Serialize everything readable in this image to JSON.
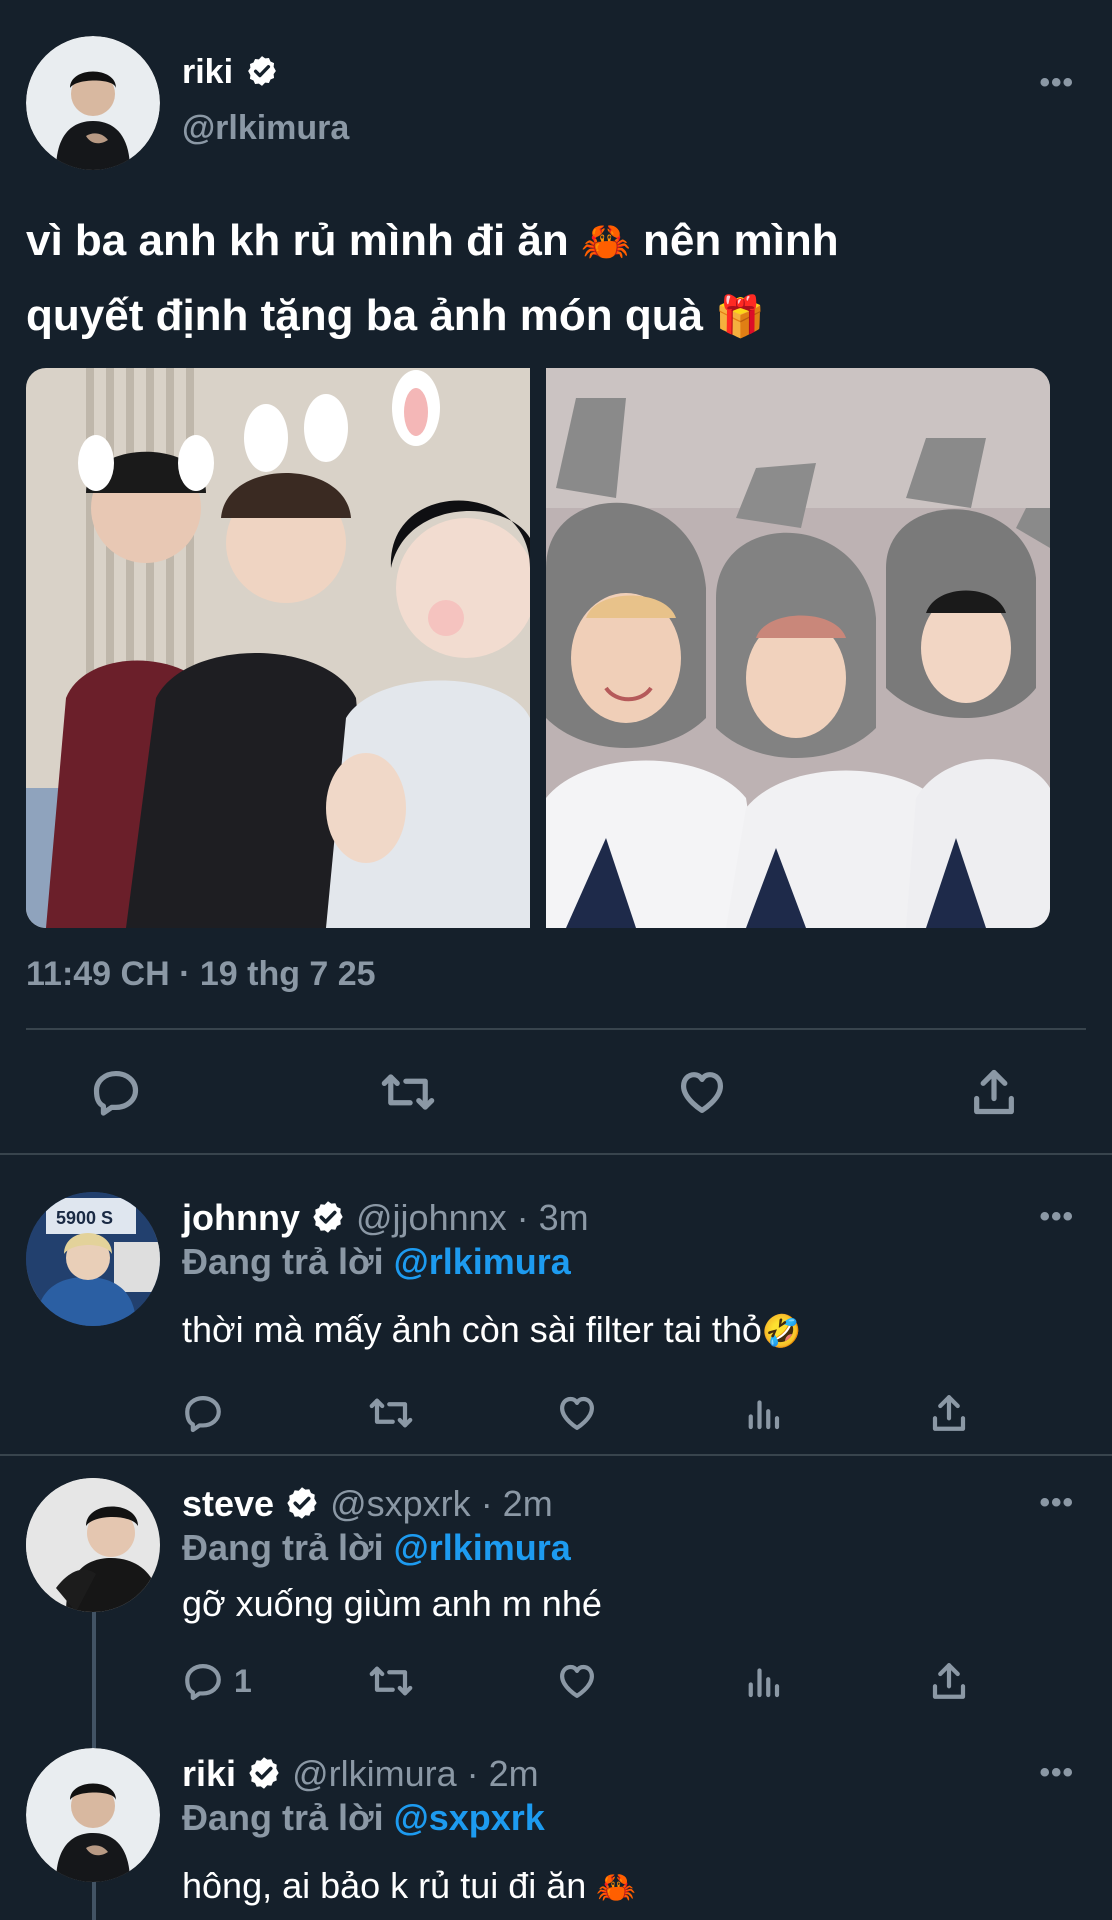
{
  "main_tweet": {
    "display_name": "riki",
    "handle": "@rlkimura",
    "text_line1": "vì ba anh kh rủ mình đi ăn",
    "emoji1": "🦀",
    "text_line1_end": "nên mình",
    "text_line2": "quyết định tặng ba ảnh món quà",
    "emoji2": "🎁",
    "timestamp": "11:49 CH · 19 thg 7 25",
    "more": "•••"
  },
  "replies": [
    {
      "display_name": "johnny",
      "handle": "@jjohnnx",
      "time": "· 3m",
      "replying_prefix": "Đang trả lời",
      "replying_to": "@rlkimura",
      "text": "thời mà mấy ảnh còn sài filter tai thỏ",
      "emoji": "🤣",
      "reply_count": ""
    },
    {
      "display_name": "steve",
      "handle": "@sxpxrk",
      "time": "· 2m",
      "replying_prefix": "Đang trả lời",
      "replying_to": "@rlkimura",
      "text": "gỡ xuống giùm anh m nhé",
      "reply_count": "1"
    },
    {
      "display_name": "riki",
      "handle": "@rlkimura",
      "time": "· 2m",
      "replying_prefix": "Đang trả lời",
      "replying_to": "@sxpxrk",
      "text": "hông, ai bảo k rủ tui đi ăn",
      "emoji": "🦀"
    }
  ],
  "icons": {
    "reply": "reply-icon",
    "retweet": "retweet-icon",
    "like": "heart-icon",
    "views": "analytics-icon",
    "share": "share-icon",
    "verified": "verified-badge-icon"
  },
  "colors": {
    "background": "#15202b",
    "link": "#1d9bf0",
    "muted": "#8b98a5",
    "divider": "#38444d"
  }
}
